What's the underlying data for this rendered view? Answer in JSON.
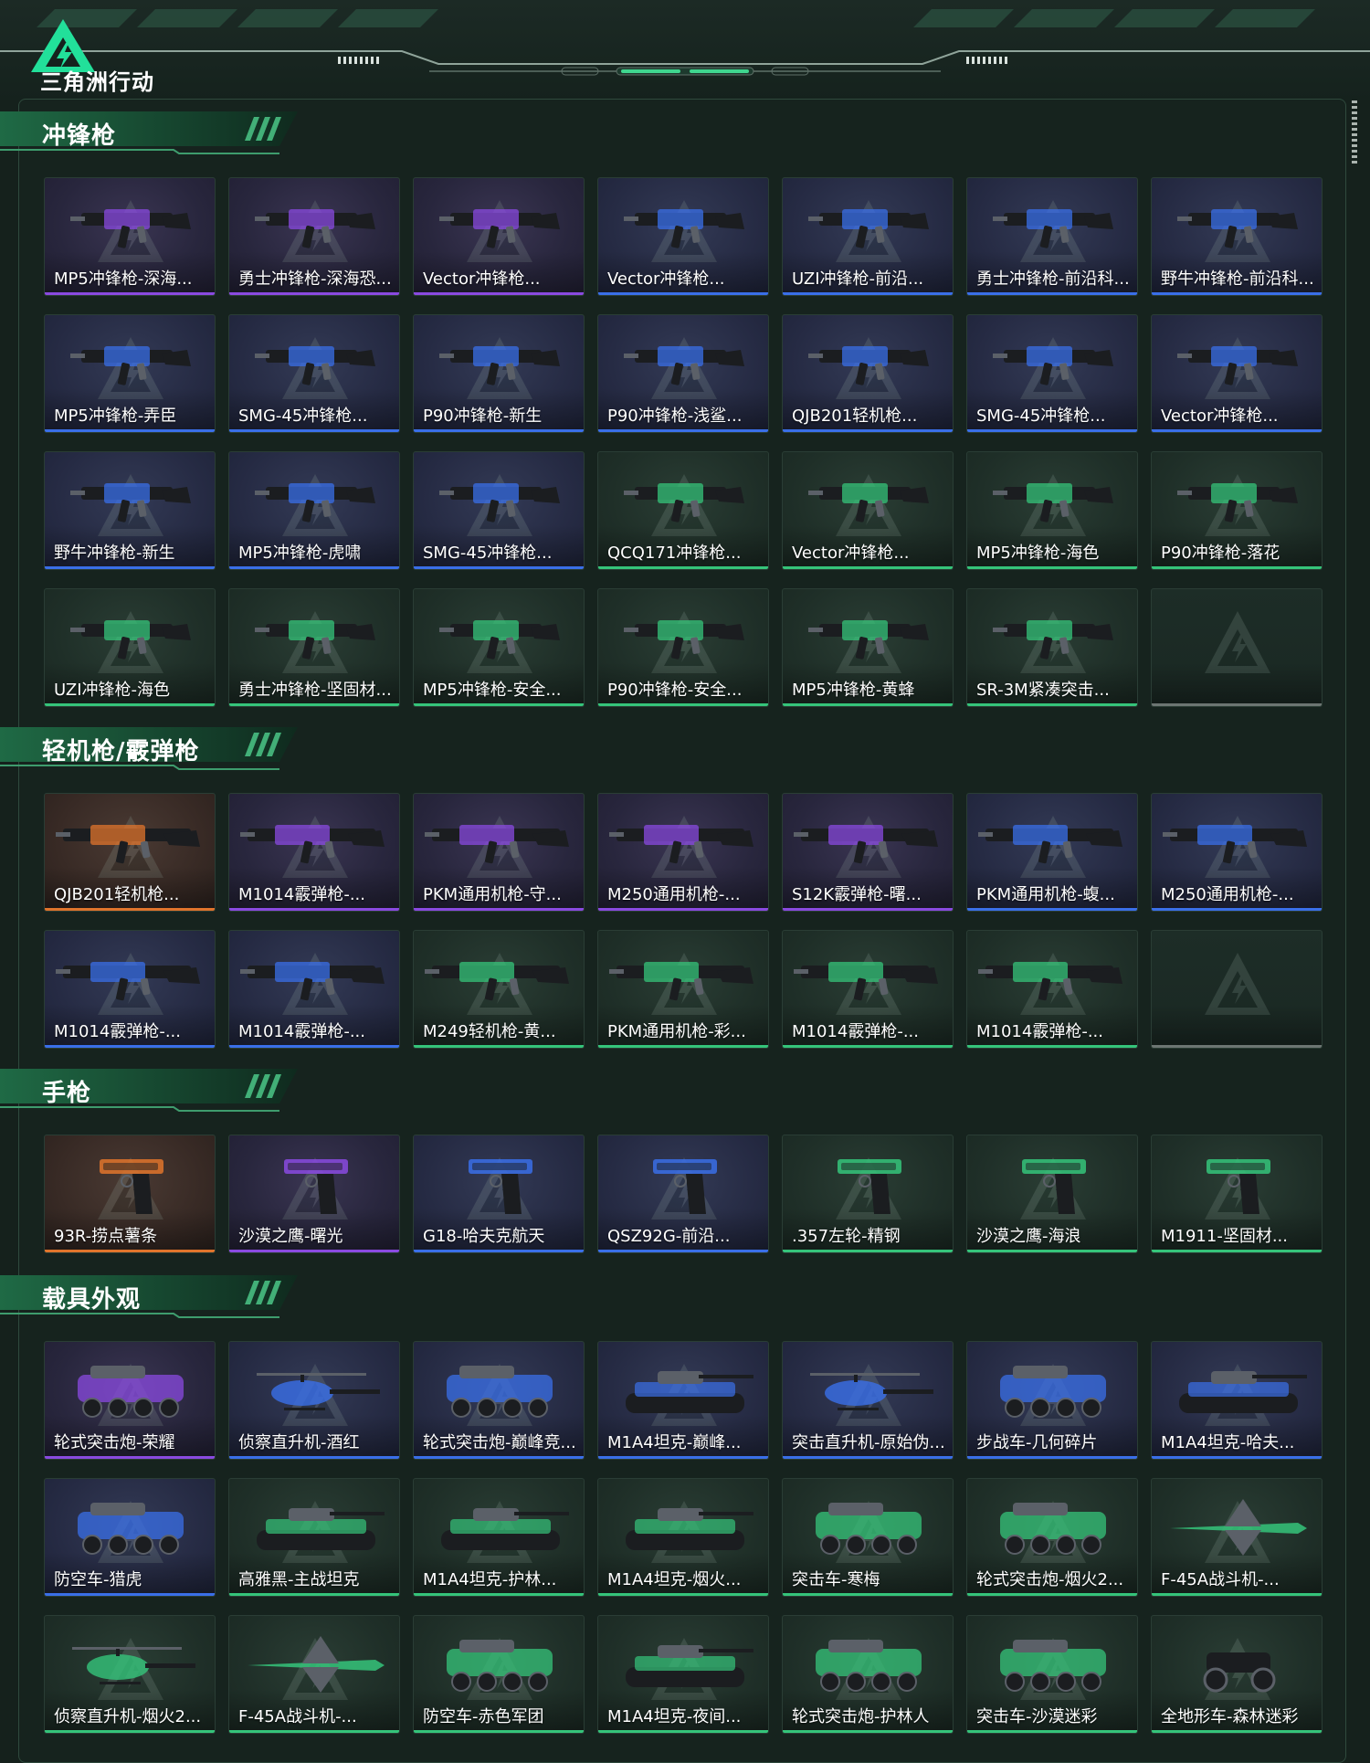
{
  "brand": {
    "name": "三角洲行动"
  },
  "colors": {
    "purple": "#8a4ae0",
    "blue": "#3a6fe8",
    "green": "#35c47a",
    "orange": "#e0742c",
    "gray": "#6c7572"
  },
  "sections": [
    {
      "title": "冲锋枪",
      "items": [
        {
          "name": "MP5冲锋枪-深海...",
          "rarity": "purple",
          "icon": "smg-icon"
        },
        {
          "name": "勇士冲锋枪-深海恐...",
          "rarity": "purple",
          "icon": "smg-icon"
        },
        {
          "name": "Vector冲锋枪...",
          "rarity": "purple",
          "icon": "smg-icon"
        },
        {
          "name": "Vector冲锋枪...",
          "rarity": "blue",
          "icon": "smg-icon"
        },
        {
          "name": "UZI冲锋枪-前沿...",
          "rarity": "blue",
          "icon": "smg-icon"
        },
        {
          "name": "勇士冲锋枪-前沿科...",
          "rarity": "blue",
          "icon": "smg-icon"
        },
        {
          "name": "野牛冲锋枪-前沿科...",
          "rarity": "blue",
          "icon": "smg-icon"
        },
        {
          "name": "MP5冲锋枪-弄臣",
          "rarity": "blue",
          "icon": "smg-icon"
        },
        {
          "name": "SMG-45冲锋枪...",
          "rarity": "blue",
          "icon": "smg-icon"
        },
        {
          "name": "P90冲锋枪-新生",
          "rarity": "blue",
          "icon": "smg-icon"
        },
        {
          "name": "P90冲锋枪-浅鲨...",
          "rarity": "blue",
          "icon": "smg-icon"
        },
        {
          "name": "QJB201轻机枪...",
          "rarity": "blue",
          "icon": "smg-icon"
        },
        {
          "name": "SMG-45冲锋枪...",
          "rarity": "blue",
          "icon": "smg-icon"
        },
        {
          "name": "Vector冲锋枪...",
          "rarity": "blue",
          "icon": "smg-icon"
        },
        {
          "name": "野牛冲锋枪-新生",
          "rarity": "blue",
          "icon": "smg-icon"
        },
        {
          "name": "MP5冲锋枪-虎啸",
          "rarity": "blue",
          "icon": "smg-icon"
        },
        {
          "name": "SMG-45冲锋枪...",
          "rarity": "blue",
          "icon": "smg-icon"
        },
        {
          "name": "QCQ171冲锋枪...",
          "rarity": "green",
          "icon": "smg-icon"
        },
        {
          "name": "Vector冲锋枪...",
          "rarity": "green",
          "icon": "smg-icon"
        },
        {
          "name": "MP5冲锋枪-海色",
          "rarity": "green",
          "icon": "smg-icon"
        },
        {
          "name": "P90冲锋枪-落花",
          "rarity": "green",
          "icon": "smg-icon"
        },
        {
          "name": "UZI冲锋枪-海色",
          "rarity": "green",
          "icon": "smg-icon"
        },
        {
          "name": "勇士冲锋枪-坚固材...",
          "rarity": "green",
          "icon": "smg-icon"
        },
        {
          "name": "MP5冲锋枪-安全...",
          "rarity": "green",
          "icon": "smg-icon"
        },
        {
          "name": "P90冲锋枪-安全...",
          "rarity": "green",
          "icon": "smg-icon"
        },
        {
          "name": "MP5冲锋枪-黄蜂",
          "rarity": "green",
          "icon": "smg-icon"
        },
        {
          "name": "SR-3M紧凑突击...",
          "rarity": "green",
          "icon": "smg-icon"
        },
        {
          "name": "",
          "rarity": "gray",
          "icon": "empty"
        }
      ]
    },
    {
      "title": "轻机枪/霰弹枪",
      "items": [
        {
          "name": "QJB201轻机枪...",
          "rarity": "orange",
          "icon": "lmg-icon"
        },
        {
          "name": "M1014霰弹枪-...",
          "rarity": "purple",
          "icon": "shotgun-icon"
        },
        {
          "name": "PKM通用机枪-守...",
          "rarity": "purple",
          "icon": "lmg-icon"
        },
        {
          "name": "M250通用机枪-...",
          "rarity": "purple",
          "icon": "lmg-icon"
        },
        {
          "name": "S12K霰弹枪-曙...",
          "rarity": "purple",
          "icon": "shotgun-icon"
        },
        {
          "name": "PKM通用机枪-蝮...",
          "rarity": "blue",
          "icon": "lmg-icon"
        },
        {
          "name": "M250通用机枪-...",
          "rarity": "blue",
          "icon": "lmg-icon"
        },
        {
          "name": "M1014霰弹枪-...",
          "rarity": "blue",
          "icon": "shotgun-icon"
        },
        {
          "name": "M1014霰弹枪-...",
          "rarity": "blue",
          "icon": "shotgun-icon"
        },
        {
          "name": "M249轻机枪-黄...",
          "rarity": "green",
          "icon": "lmg-icon"
        },
        {
          "name": "PKM通用机枪-彩...",
          "rarity": "green",
          "icon": "lmg-icon"
        },
        {
          "name": "M1014霰弹枪-...",
          "rarity": "green",
          "icon": "shotgun-icon"
        },
        {
          "name": "M1014霰弹枪-...",
          "rarity": "green",
          "icon": "shotgun-icon"
        },
        {
          "name": "",
          "rarity": "gray",
          "icon": "empty"
        }
      ]
    },
    {
      "title": "手枪",
      "items": [
        {
          "name": "93R-捞点薯条",
          "rarity": "orange",
          "icon": "pistol-icon"
        },
        {
          "name": "沙漠之鹰-曙光",
          "rarity": "purple",
          "icon": "pistol-icon"
        },
        {
          "name": "G18-哈夫克航天",
          "rarity": "blue",
          "icon": "pistol-icon"
        },
        {
          "name": "QSZ92G-前沿...",
          "rarity": "blue",
          "icon": "pistol-icon"
        },
        {
          "name": ".357左轮-精钢",
          "rarity": "green",
          "icon": "pistol-icon"
        },
        {
          "name": "沙漠之鹰-海浪",
          "rarity": "green",
          "icon": "pistol-icon"
        },
        {
          "name": "M1911-坚固材...",
          "rarity": "green",
          "icon": "pistol-icon"
        }
      ]
    },
    {
      "title": "载具外观",
      "items": [
        {
          "name": "轮式突击炮-荣耀",
          "rarity": "purple",
          "icon": "vehicle-icon"
        },
        {
          "name": "侦察直升机-酒红",
          "rarity": "blue",
          "icon": "helicopter-icon"
        },
        {
          "name": "轮式突击炮-巅峰竞...",
          "rarity": "blue",
          "icon": "vehicle-icon"
        },
        {
          "name": "M1A4坦克-巅峰...",
          "rarity": "blue",
          "icon": "tank-icon"
        },
        {
          "name": "突击直升机-原始伪...",
          "rarity": "blue",
          "icon": "helicopter-icon"
        },
        {
          "name": "步战车-几何碎片",
          "rarity": "blue",
          "icon": "vehicle-icon"
        },
        {
          "name": "M1A4坦克-哈夫...",
          "rarity": "blue",
          "icon": "tank-icon"
        },
        {
          "name": "防空车-猎虎",
          "rarity": "blue",
          "icon": "vehicle-icon"
        },
        {
          "name": "高雅黑-主战坦克",
          "rarity": "green",
          "icon": "tank-icon"
        },
        {
          "name": "M1A4坦克-护林...",
          "rarity": "green",
          "icon": "tank-icon"
        },
        {
          "name": "M1A4坦克-烟火...",
          "rarity": "green",
          "icon": "tank-icon"
        },
        {
          "name": "突击车-寒梅",
          "rarity": "green",
          "icon": "vehicle-icon"
        },
        {
          "name": "轮式突击炮-烟火2...",
          "rarity": "green",
          "icon": "vehicle-icon"
        },
        {
          "name": "F-45A战斗机-...",
          "rarity": "green",
          "icon": "jet-icon"
        },
        {
          "name": "侦察直升机-烟火2...",
          "rarity": "green",
          "icon": "helicopter-icon"
        },
        {
          "name": "F-45A战斗机-...",
          "rarity": "green",
          "icon": "jet-icon"
        },
        {
          "name": "防空车-赤色军团",
          "rarity": "green",
          "icon": "vehicle-icon"
        },
        {
          "name": "M1A4坦克-夜间...",
          "rarity": "green",
          "icon": "tank-icon"
        },
        {
          "name": "轮式突击炮-护林人",
          "rarity": "green",
          "icon": "vehicle-icon"
        },
        {
          "name": "突击车-沙漠迷彩",
          "rarity": "green",
          "icon": "vehicle-icon"
        },
        {
          "name": "全地形车-森林迷彩",
          "rarity": "green",
          "icon": "atv-icon"
        }
      ]
    }
  ]
}
